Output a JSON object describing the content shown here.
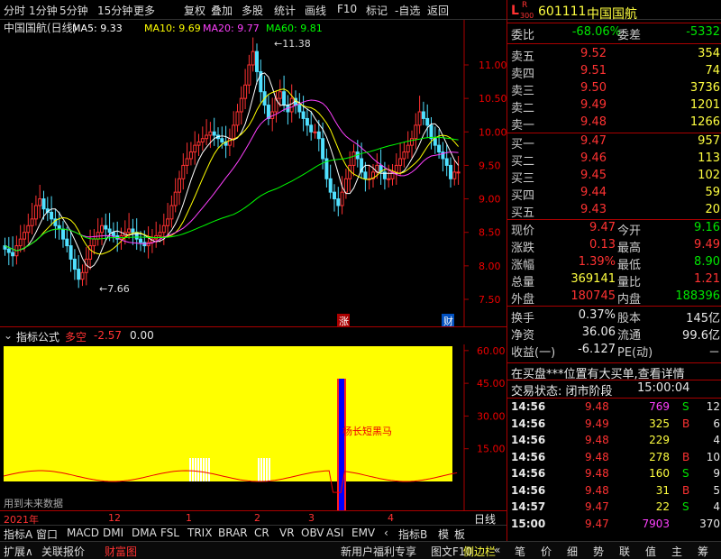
{
  "toolbar": {
    "items": [
      "分时",
      "1分钟",
      "5分钟",
      "15分钟",
      "更多",
      "复权",
      "叠加",
      "多股",
      "统计",
      "画线",
      "F10",
      "标记",
      "-自选",
      "返回"
    ]
  },
  "chart": {
    "title": "中国国航(日线)",
    "ma": [
      {
        "label": "MA5: 9.33",
        "color": "#ffffff"
      },
      {
        "label": "MA10: 9.69",
        "color": "#ffff00"
      },
      {
        "label": "MA20: 9.77",
        "color": "#ff40ff"
      },
      {
        "label": "MA60: 9.81",
        "color": "#00ff00"
      }
    ],
    "high_label": "11.38",
    "low_label": "7.66",
    "yticks": [
      "11.00",
      "10.50",
      "10.00",
      "9.50",
      "9.00",
      "8.50",
      "8.00",
      "7.50"
    ],
    "markers": {
      "zhang": "涨",
      "cai": "财"
    }
  },
  "indicator": {
    "name": "指标公式",
    "signal": "多空",
    "value1": "-2.57",
    "value2": "0.00",
    "annotation": "杨长短黑马",
    "yticks": [
      "60.00",
      "45.00",
      "30.00",
      "15.00"
    ],
    "future_note": "用到未来数据"
  },
  "timeaxis": {
    "labels": [
      "2021年",
      "12",
      "1",
      "2",
      "3",
      "4"
    ],
    "period": "日线"
  },
  "tabs": {
    "items": [
      "指标A",
      "窗口",
      "MACD",
      "DMI",
      "DMA",
      "FSL",
      "TRIX",
      "BRAR",
      "CR",
      "VR",
      "OBV",
      "ASI",
      "EMV",
      "‹",
      "指标B",
      "模",
      "板"
    ]
  },
  "bottom": {
    "left": [
      "扩展∧",
      "关联报价",
      "财富图"
    ],
    "mid": [
      "新用户福利专享",
      "图文F10",
      "侧边栏",
      "«"
    ],
    "right": [
      "笔",
      "价",
      "细",
      "势",
      "联",
      "值",
      "主",
      "筹"
    ]
  },
  "quote": {
    "code": "601111",
    "name": "中国国航",
    "badge_top": "R",
    "badge_bottom": "300",
    "badge_l": "L",
    "weibi_label": "委比",
    "weibi": "-68.06%",
    "weicha_label": "委差",
    "weicha": "-5332",
    "sells": [
      {
        "l": "卖五",
        "p": "9.52",
        "v": "354"
      },
      {
        "l": "卖四",
        "p": "9.51",
        "v": "74"
      },
      {
        "l": "卖三",
        "p": "9.50",
        "v": "3736"
      },
      {
        "l": "卖二",
        "p": "9.49",
        "v": "1201"
      },
      {
        "l": "卖一",
        "p": "9.48",
        "v": "1266"
      }
    ],
    "buys": [
      {
        "l": "买一",
        "p": "9.47",
        "v": "957"
      },
      {
        "l": "买二",
        "p": "9.46",
        "v": "113"
      },
      {
        "l": "买三",
        "p": "9.45",
        "v": "102"
      },
      {
        "l": "买四",
        "p": "9.44",
        "v": "59"
      },
      {
        "l": "买五",
        "p": "9.43",
        "v": "20"
      }
    ],
    "stats": [
      {
        "l1": "现价",
        "v1": "9.47",
        "c1": "red",
        "l2": "今开",
        "v2": "9.16",
        "c2": "grn"
      },
      {
        "l1": "涨跌",
        "v1": "0.13",
        "c1": "red",
        "l2": "最高",
        "v2": "9.49",
        "c2": "red"
      },
      {
        "l1": "涨幅",
        "v1": "1.39%",
        "c1": "red",
        "l2": "最低",
        "v2": "8.90",
        "c2": "grn"
      },
      {
        "l1": "总量",
        "v1": "369141",
        "c1": "yel",
        "l2": "量比",
        "v2": "1.21",
        "c2": "red"
      },
      {
        "l1": "外盘",
        "v1": "180745",
        "c1": "red",
        "l2": "内盘",
        "v2": "188396",
        "c2": "grn"
      }
    ],
    "stats2": [
      {
        "l1": "换手",
        "v1": "0.37%",
        "l2": "股本",
        "v2": "145亿"
      },
      {
        "l1": "净资",
        "v1": "36.06",
        "l2": "流通",
        "v2": "99.6亿"
      },
      {
        "l1": "收益(一)",
        "v1": "-6.127",
        "l2": "PE(动)",
        "v2": "－"
      }
    ],
    "news": "在买盘***位置有大买单,查看详情",
    "status_label": "交易状态: 闭市阶段",
    "status_time": "15:00:04",
    "trades": [
      {
        "t": "14:56",
        "p": "9.48",
        "v": "769",
        "s": "S",
        "n": "12",
        "vc": "mag"
      },
      {
        "t": "14:56",
        "p": "9.49",
        "v": "325",
        "s": "B",
        "n": "6",
        "vc": "yel"
      },
      {
        "t": "14:56",
        "p": "9.48",
        "v": "229",
        "s": "",
        "n": "4",
        "vc": "yel"
      },
      {
        "t": "14:56",
        "p": "9.48",
        "v": "278",
        "s": "B",
        "n": "10",
        "vc": "yel"
      },
      {
        "t": "14:56",
        "p": "9.48",
        "v": "160",
        "s": "S",
        "n": "9",
        "vc": "yel"
      },
      {
        "t": "14:56",
        "p": "9.48",
        "v": "31",
        "s": "B",
        "n": "5",
        "vc": "yel"
      },
      {
        "t": "14:57",
        "p": "9.47",
        "v": "22",
        "s": "S",
        "n": "4",
        "vc": "yel"
      },
      {
        "t": "15:00",
        "p": "9.47",
        "v": "7903",
        "s": "",
        "n": "370",
        "vc": "mag"
      }
    ]
  }
}
